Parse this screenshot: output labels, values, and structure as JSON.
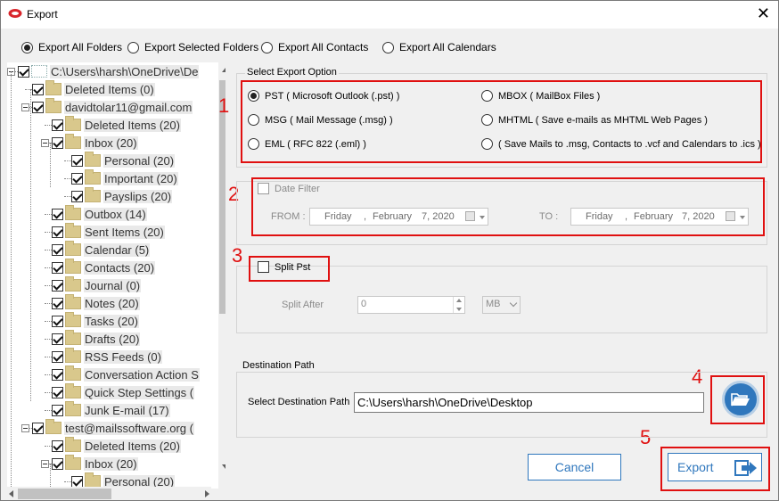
{
  "window": {
    "title": "Export",
    "close": "✕"
  },
  "scope_options": [
    {
      "label": "Export All Folders",
      "checked": true
    },
    {
      "label": "Export Selected Folders",
      "checked": false
    },
    {
      "label": "Export All Contacts",
      "checked": false
    },
    {
      "label": "Export All Calendars",
      "checked": false
    }
  ],
  "tree": [
    {
      "label": "C:\\Users\\harsh\\OneDrive\\De",
      "level": 0,
      "expander": true,
      "blank": true
    },
    {
      "label": "Deleted Items (0)",
      "level": 1
    },
    {
      "label": "davidtolar11@gmail.com",
      "level": 1,
      "expander": true
    },
    {
      "label": "Deleted Items (20)",
      "level": 2
    },
    {
      "label": "Inbox (20)",
      "level": 2,
      "expander": true
    },
    {
      "label": "Personal (20)",
      "level": 3
    },
    {
      "label": "Important (20)",
      "level": 3
    },
    {
      "label": "Payslips (20)",
      "level": 3
    },
    {
      "label": "Outbox (14)",
      "level": 2
    },
    {
      "label": "Sent Items (20)",
      "level": 2
    },
    {
      "label": "Calendar (5)",
      "level": 2
    },
    {
      "label": "Contacts (20)",
      "level": 2
    },
    {
      "label": "Journal (0)",
      "level": 2
    },
    {
      "label": "Notes (20)",
      "level": 2
    },
    {
      "label": "Tasks (20)",
      "level": 2
    },
    {
      "label": "Drafts (20)",
      "level": 2
    },
    {
      "label": "RSS Feeds (0)",
      "level": 2
    },
    {
      "label": "Conversation Action S",
      "level": 2
    },
    {
      "label": "Quick Step Settings (",
      "level": 2
    },
    {
      "label": "Junk E-mail (17)",
      "level": 2
    },
    {
      "label": "test@mailssoftware.org (",
      "level": 1,
      "expander": true
    },
    {
      "label": "Deleted Items (20)",
      "level": 2
    },
    {
      "label": "Inbox (20)",
      "level": 2,
      "expander": true
    },
    {
      "label": "Personal (20)",
      "level": 3
    }
  ],
  "export_option": {
    "title": "Select Export Option",
    "options": [
      {
        "label": "PST ( Microsoft Outlook (.pst) )",
        "checked": true
      },
      {
        "label": "MBOX ( MailBox Files )",
        "checked": false
      },
      {
        "label": "MSG ( Mail Message (.msg) )",
        "checked": false
      },
      {
        "label": "MHTML ( Save e-mails as MHTML Web Pages )",
        "checked": false
      },
      {
        "label": "EML ( RFC 822 (.eml) )",
        "checked": false
      },
      {
        "label": "( Save Mails to .msg, Contacts to .vcf and Calendars to .ics )",
        "checked": false
      }
    ]
  },
  "date_filter": {
    "label": "Date Filter",
    "from_label": "FROM :",
    "to_label": "TO :",
    "from": {
      "day": "Friday",
      "sep": ",",
      "month": "February",
      "date": "7, 2020"
    },
    "to": {
      "day": "Friday",
      "sep": ",",
      "month": "February",
      "date": "7, 2020"
    }
  },
  "split": {
    "label": "Split Pst",
    "after_label": "Split After",
    "value": "0",
    "unit": "MB"
  },
  "destination": {
    "title": "Destination Path",
    "label": "Select Destination Path",
    "value": "C:\\Users\\harsh\\OneDrive\\Desktop"
  },
  "steps": [
    "1",
    "2",
    "3",
    "4",
    "5"
  ],
  "buttons": {
    "cancel": "Cancel",
    "export": "Export"
  },
  "colors": {
    "accent": "#2f77bd",
    "highlight": "#e01010"
  }
}
